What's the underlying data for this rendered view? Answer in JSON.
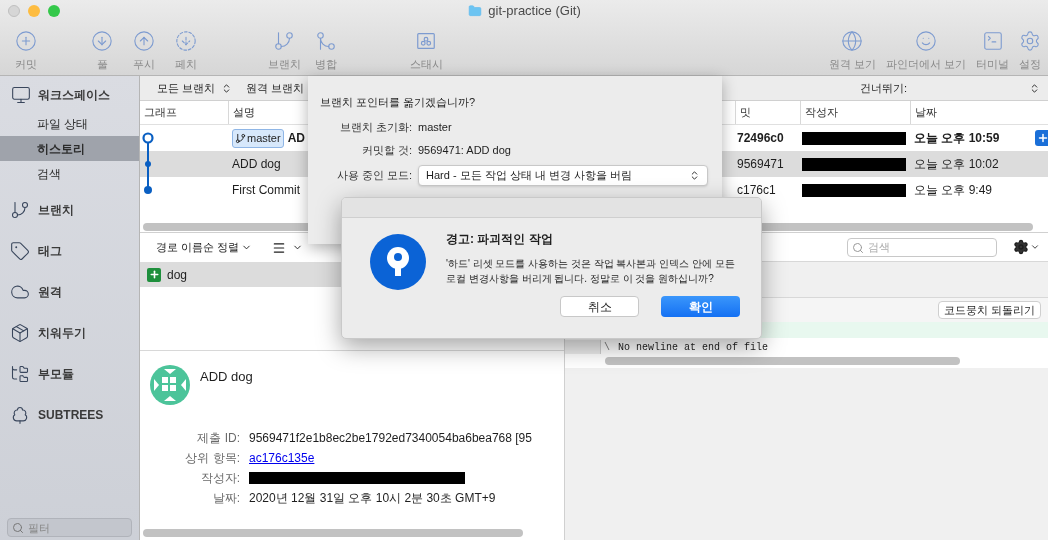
{
  "window": {
    "title": "git-practice (Git)"
  },
  "toolbar": {
    "groups": [
      {
        "items": [
          {
            "label": "커밋"
          }
        ]
      },
      {
        "items": [
          {
            "label": "풀"
          },
          {
            "label": "푸시"
          },
          {
            "label": "페치"
          }
        ]
      },
      {
        "items": [
          {
            "label": "브랜치"
          },
          {
            "label": "병합"
          }
        ]
      },
      {
        "items": [
          {
            "label": "스태시"
          }
        ]
      }
    ],
    "right": [
      {
        "label": "원격 보기"
      },
      {
        "label": "파인더에서 보기"
      },
      {
        "label": "터미널"
      },
      {
        "label": "설정"
      }
    ]
  },
  "sidebar": {
    "workspace": {
      "label": "워크스페이스",
      "items": [
        {
          "label": "파일 상태",
          "selected": false
        },
        {
          "label": "히스토리",
          "selected": true
        },
        {
          "label": "검색",
          "selected": false
        }
      ]
    },
    "groups": [
      {
        "label": "브랜치"
      },
      {
        "label": "태그"
      },
      {
        "label": "원격"
      },
      {
        "label": "치워두기"
      },
      {
        "label": "부모듈"
      },
      {
        "label": "SUBTREES"
      }
    ],
    "filter": {
      "placeholder": "필터"
    }
  },
  "branch_bar": {
    "branch_filter": "모든 브랜치",
    "remote_filter": "원격 브랜치",
    "jump": "건너뛰기:"
  },
  "history": {
    "columns": [
      "그래프",
      "설명",
      "밋",
      "작성자",
      "날짜"
    ],
    "rows": [
      {
        "branch": "master",
        "description": "AD",
        "commit": "72496c0",
        "date": "오늘 오후 10:59",
        "head": true,
        "selected": false
      },
      {
        "description": "ADD dog",
        "commit": "9569471",
        "date": "오늘 오후 10:02",
        "head": false,
        "selected": true
      },
      {
        "description": "First Commit",
        "commit": "c176c1",
        "date": "오늘 오후 9:49",
        "head": false,
        "selected": false
      }
    ]
  },
  "files": {
    "sort": "경로 이름순 정렬",
    "items": [
      {
        "name": "dog",
        "kind": "added",
        "selected": true
      }
    ]
  },
  "commit_details": {
    "message": "ADD dog",
    "fields": [
      {
        "label": "제출 ID:",
        "value": "9569471f2e1b8ec2be1792ed7340054ba6bea768 [95",
        "kind": "text"
      },
      {
        "label": "상위 항목:",
        "value": "ac176c135e",
        "kind": "link"
      },
      {
        "label": "작성자:",
        "kind": "redacted"
      },
      {
        "label": "날짜:",
        "value": "2020년 12월 31일 오후 10시 2분 30초 GMT+9",
        "kind": "text"
      }
    ]
  },
  "diff": {
    "search_placeholder": "검색",
    "hunk_button": "코드뭉치 되돌리기",
    "lines": [
      {
        "kind": "added"
      },
      {
        "kind": "context",
        "marker": "\\",
        "text": "No newline at end of file"
      }
    ]
  },
  "reset_sheet": {
    "question": "브랜치 포인터를 옮기겠습니까?",
    "fields": [
      {
        "label": "브랜치 초기화:",
        "value": "master"
      },
      {
        "label": "커밋할 것:",
        "value": "9569471: ADD dog"
      }
    ],
    "mode": {
      "label": "사용 중인 모드:",
      "value": "Hard - 모든 작업 상태 내 변경 사항을 버림"
    }
  },
  "alert": {
    "title": "경고: 파괴적인 작업",
    "message": "'하드' 리셋 모드를 사용하는 것은 작업 복사본과 인덱스 안에 모든 로컬 변경사항을 버리게 됩니다. 정말로 이 것을 원하십니까?",
    "buttons": [
      {
        "label": "취소",
        "default": false
      },
      {
        "label": "확인",
        "default": true
      }
    ]
  }
}
